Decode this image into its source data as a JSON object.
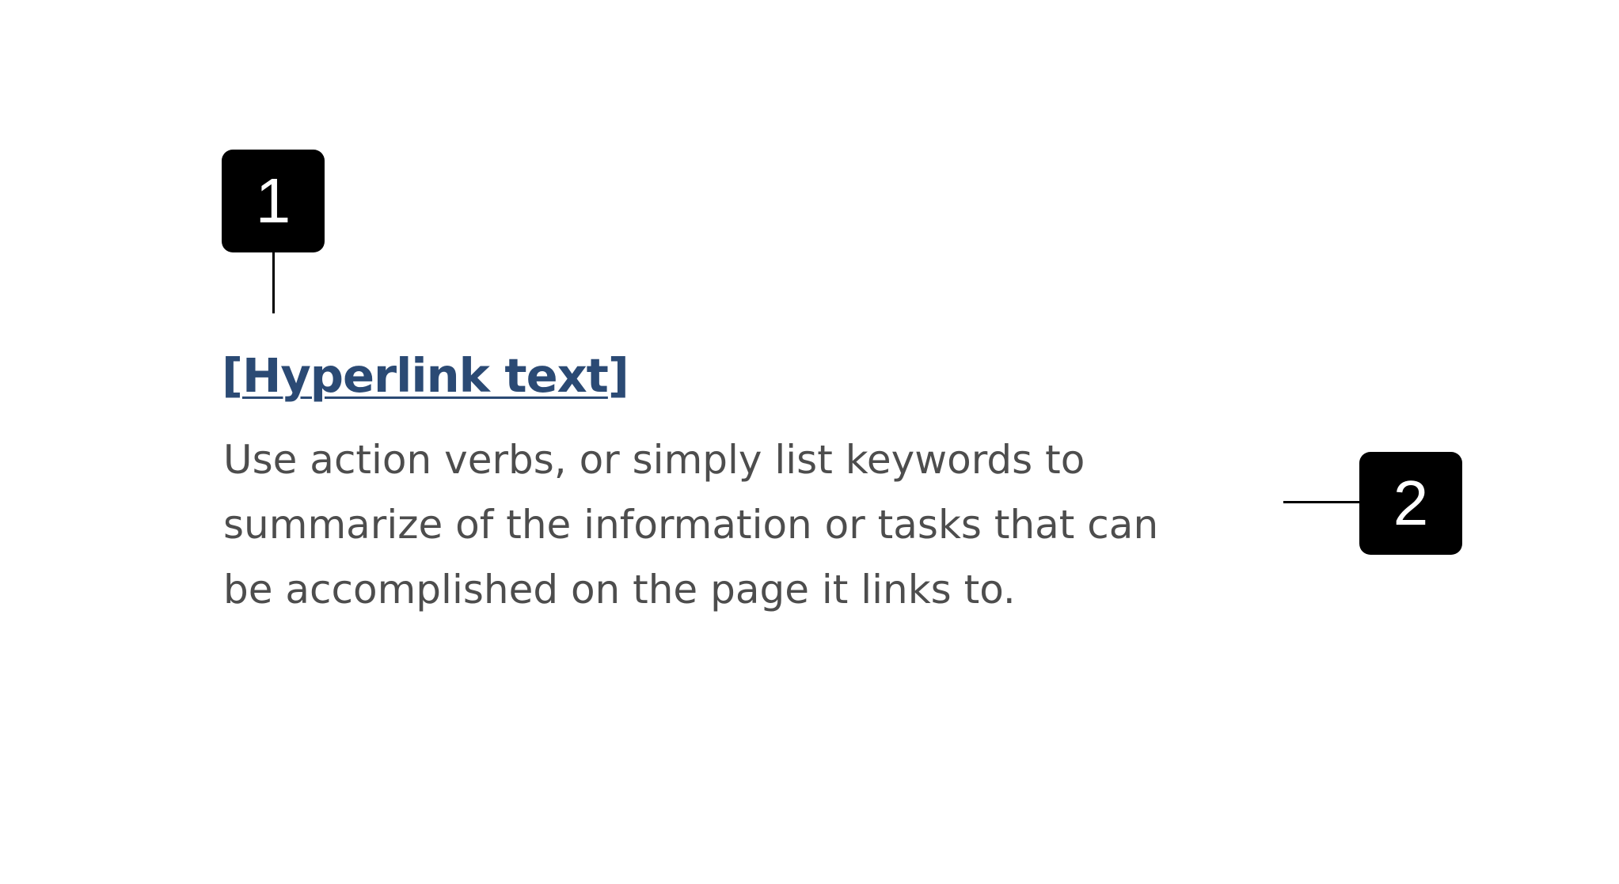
{
  "callouts": [
    {
      "number": "1"
    },
    {
      "number": "2"
    }
  ],
  "link": {
    "open_bracket": "[",
    "text": "Hyperlink text",
    "close_bracket": "]"
  },
  "description": {
    "lines": [
      "Use action verbs, or simply list keywords to",
      "summarize of the information or tasks that can",
      "be accomplished on the page it links to."
    ]
  },
  "colors": {
    "link": "#2b4a74",
    "body_text": "#4d4d4d",
    "badge": "#000000"
  }
}
